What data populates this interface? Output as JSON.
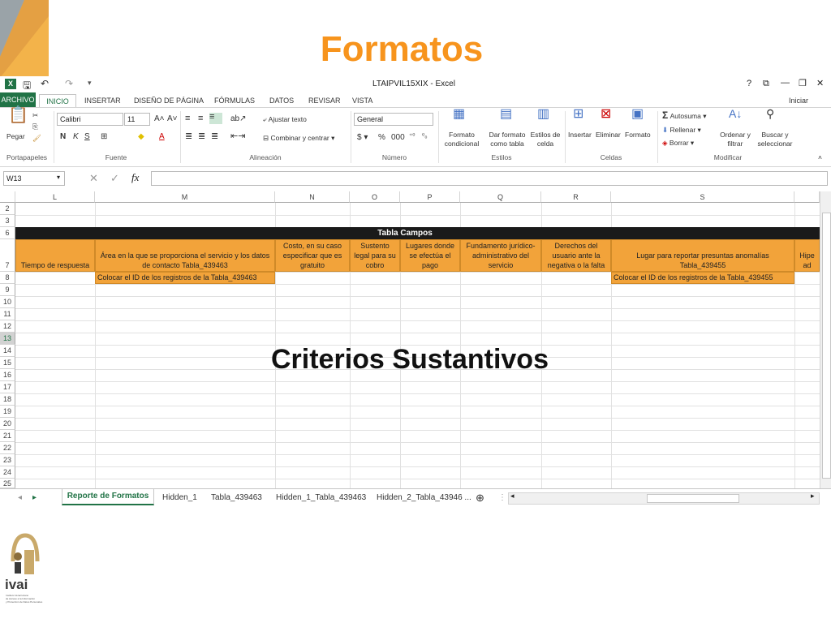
{
  "slide": {
    "title": "Formatos",
    "caption": "Criterios Sustantivos",
    "logo_text": "ivai",
    "logo_subtext": "Instituto Veracruzano de Acceso a la Información y Protección de Datos Personales"
  },
  "window": {
    "title": "LTAIPVIL15XIX - Excel",
    "controls": [
      "?",
      "⧉",
      "—",
      "❐",
      "✕"
    ],
    "sign_in": "Iniciar sesión"
  },
  "ribbon_tabs": [
    "ARCHIVO",
    "INICIO",
    "INSERTAR",
    "DISEÑO DE PÁGINA",
    "FÓRMULAS",
    "DATOS",
    "REVISAR",
    "VISTA"
  ],
  "ribbon": {
    "paste_label": "Pegar",
    "font_name": "Calibri",
    "font_size": "11",
    "wrap_text": "Ajustar texto",
    "merge_center": "Combinar y centrar",
    "number_format": "General",
    "cond_format": "Formato condicional",
    "format_table": "Dar formato como tabla",
    "cell_styles": "Estilos de celda",
    "insert": "Insertar",
    "delete": "Eliminar",
    "format": "Formato",
    "autosum": "Autosuma",
    "fill": "Rellenar",
    "clear": "Borrar",
    "sort_filter": "Ordenar y filtrar",
    "find_select": "Buscar y seleccionar",
    "groups": [
      "Portapapeles",
      "Fuente",
      "Alineación",
      "Número",
      "Estilos",
      "Celdas",
      "Modificar"
    ]
  },
  "formula_bar": {
    "name_box": "W13",
    "fx": "fx",
    "formula": ""
  },
  "columns": [
    "L",
    "M",
    "N",
    "O",
    "P",
    "Q",
    "R",
    "S"
  ],
  "rows": [
    "2",
    "3",
    "6",
    "7",
    "8",
    "9",
    "10",
    "11",
    "12",
    "13",
    "14",
    "15",
    "16",
    "17",
    "18",
    "19",
    "20",
    "21",
    "22",
    "23",
    "24",
    "25"
  ],
  "table": {
    "title": "Tabla Campos",
    "headers": [
      "Tiempo de respuesta",
      "Área en la que se proporciona el servicio y los datos de contacto Tabla_439463",
      "Costo, en su caso especificar que es gratuito",
      "Sustento legal para su cobro",
      "Lugares donde se efectúa el pago",
      "Fundamento jurídico-administrativo del servicio",
      "Derechos del usuario ante la negativa o la falta",
      "Lugar para reportar presuntas anomalías Tabla_439455",
      "Hipe ad"
    ],
    "row8_m": "Colocar el ID de los registros de la Tabla_439463",
    "row8_s": "Colocar el ID de los registros de la Tabla_439455"
  },
  "sheet_tabs": [
    "Reporte de Formatos",
    "Hidden_1",
    "Tabla_439463",
    "Hidden_1_Tabla_439463",
    "Hidden_2_Tabla_43946 ..."
  ],
  "colors": {
    "title_orange": "#f7941d",
    "excel_green": "#217346",
    "header_orange": "#f2a33a",
    "highlight_yellow": "#ffff00"
  }
}
